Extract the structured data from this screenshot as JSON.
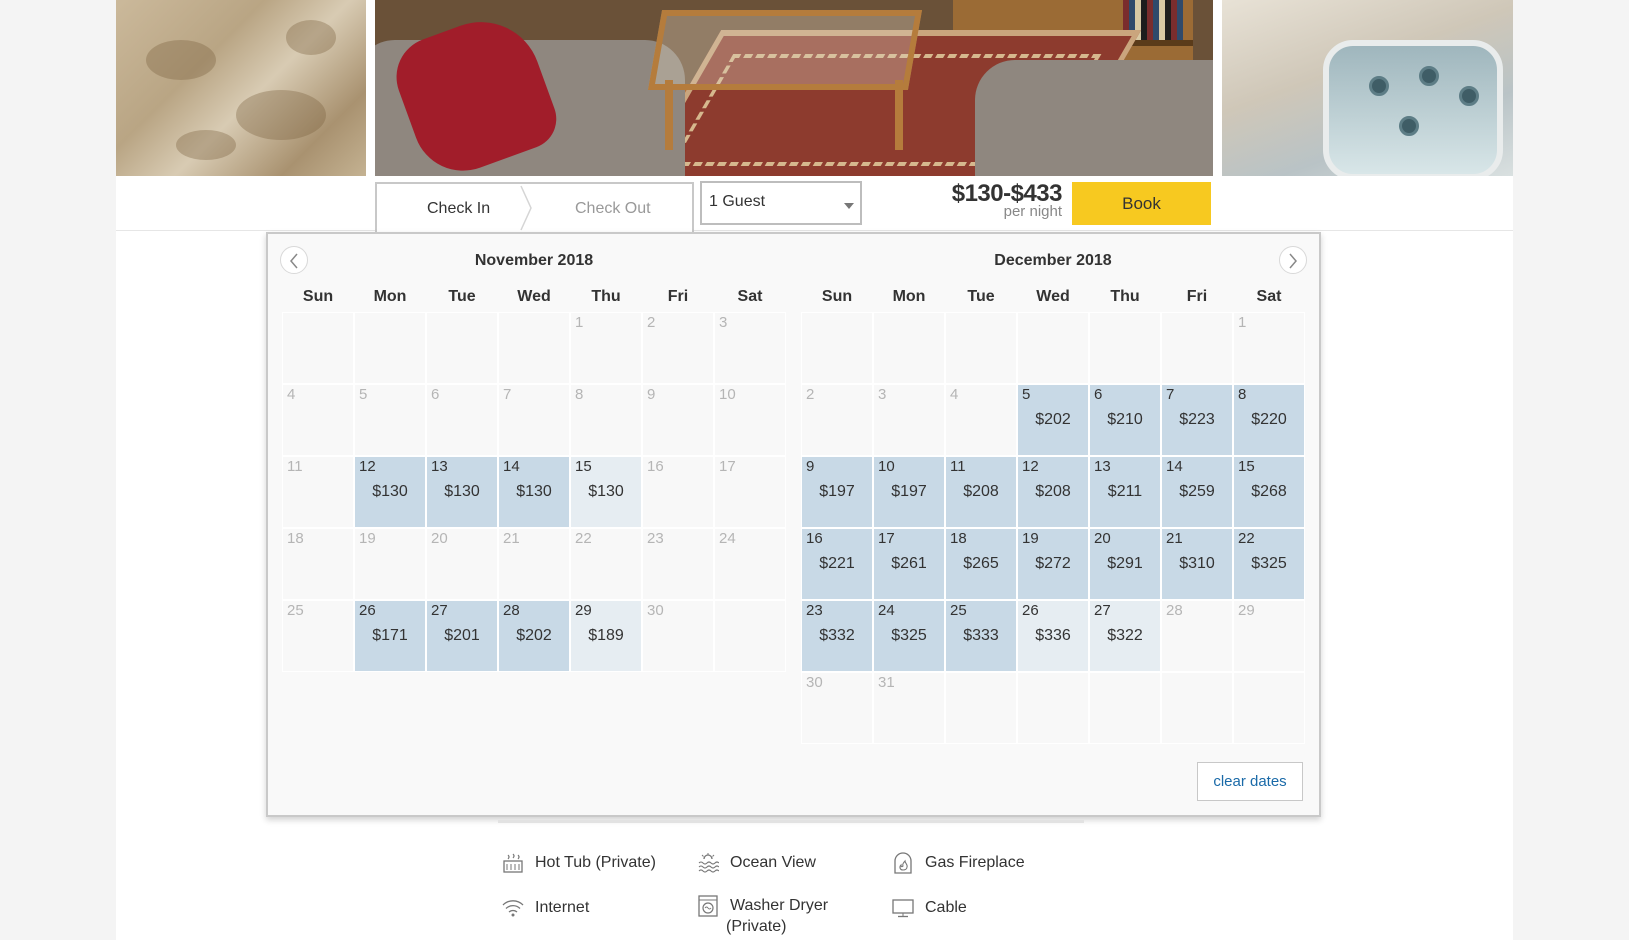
{
  "booking": {
    "check_in_label": "Check In",
    "check_out_label": "Check Out",
    "guests_value": "1 Guest",
    "price_range": "$130-$433",
    "per_night": "per night",
    "book_label": "Book"
  },
  "calendar": {
    "weekdays": [
      "Sun",
      "Mon",
      "Tue",
      "Wed",
      "Thu",
      "Fri",
      "Sat"
    ],
    "months": [
      {
        "title": "November 2018",
        "days": [
          {
            "d": "",
            "p": "",
            "s": "empty"
          },
          {
            "d": "",
            "p": "",
            "s": "empty"
          },
          {
            "d": "",
            "p": "",
            "s": "empty"
          },
          {
            "d": "",
            "p": "",
            "s": "empty"
          },
          {
            "d": "1",
            "p": "",
            "s": "na"
          },
          {
            "d": "2",
            "p": "",
            "s": "na"
          },
          {
            "d": "3",
            "p": "",
            "s": "na"
          },
          {
            "d": "4",
            "p": "",
            "s": "na"
          },
          {
            "d": "5",
            "p": "",
            "s": "na"
          },
          {
            "d": "6",
            "p": "",
            "s": "na"
          },
          {
            "d": "7",
            "p": "",
            "s": "na"
          },
          {
            "d": "8",
            "p": "",
            "s": "na"
          },
          {
            "d": "9",
            "p": "",
            "s": "na"
          },
          {
            "d": "10",
            "p": "",
            "s": "na"
          },
          {
            "d": "11",
            "p": "",
            "s": "na"
          },
          {
            "d": "12",
            "p": "$130",
            "s": "avail"
          },
          {
            "d": "13",
            "p": "$130",
            "s": "avail"
          },
          {
            "d": "14",
            "p": "$130",
            "s": "avail"
          },
          {
            "d": "15",
            "p": "$130",
            "s": "partial"
          },
          {
            "d": "16",
            "p": "",
            "s": "na"
          },
          {
            "d": "17",
            "p": "",
            "s": "na"
          },
          {
            "d": "18",
            "p": "",
            "s": "na"
          },
          {
            "d": "19",
            "p": "",
            "s": "na"
          },
          {
            "d": "20",
            "p": "",
            "s": "na"
          },
          {
            "d": "21",
            "p": "",
            "s": "na"
          },
          {
            "d": "22",
            "p": "",
            "s": "na"
          },
          {
            "d": "23",
            "p": "",
            "s": "na"
          },
          {
            "d": "24",
            "p": "",
            "s": "na"
          },
          {
            "d": "25",
            "p": "",
            "s": "na"
          },
          {
            "d": "26",
            "p": "$171",
            "s": "avail"
          },
          {
            "d": "27",
            "p": "$201",
            "s": "avail"
          },
          {
            "d": "28",
            "p": "$202",
            "s": "avail"
          },
          {
            "d": "29",
            "p": "$189",
            "s": "partial"
          },
          {
            "d": "30",
            "p": "",
            "s": "na"
          },
          {
            "d": "",
            "p": "",
            "s": "empty"
          }
        ]
      },
      {
        "title": "December 2018",
        "days": [
          {
            "d": "",
            "p": "",
            "s": "empty"
          },
          {
            "d": "",
            "p": "",
            "s": "empty"
          },
          {
            "d": "",
            "p": "",
            "s": "empty"
          },
          {
            "d": "",
            "p": "",
            "s": "empty"
          },
          {
            "d": "",
            "p": "",
            "s": "empty"
          },
          {
            "d": "",
            "p": "",
            "s": "empty"
          },
          {
            "d": "1",
            "p": "",
            "s": "na"
          },
          {
            "d": "2",
            "p": "",
            "s": "na"
          },
          {
            "d": "3",
            "p": "",
            "s": "na"
          },
          {
            "d": "4",
            "p": "",
            "s": "na"
          },
          {
            "d": "5",
            "p": "$202",
            "s": "avail"
          },
          {
            "d": "6",
            "p": "$210",
            "s": "avail"
          },
          {
            "d": "7",
            "p": "$223",
            "s": "avail"
          },
          {
            "d": "8",
            "p": "$220",
            "s": "avail"
          },
          {
            "d": "9",
            "p": "$197",
            "s": "avail"
          },
          {
            "d": "10",
            "p": "$197",
            "s": "avail"
          },
          {
            "d": "11",
            "p": "$208",
            "s": "avail"
          },
          {
            "d": "12",
            "p": "$208",
            "s": "avail"
          },
          {
            "d": "13",
            "p": "$211",
            "s": "avail"
          },
          {
            "d": "14",
            "p": "$259",
            "s": "avail"
          },
          {
            "d": "15",
            "p": "$268",
            "s": "avail"
          },
          {
            "d": "16",
            "p": "$221",
            "s": "avail"
          },
          {
            "d": "17",
            "p": "$261",
            "s": "avail"
          },
          {
            "d": "18",
            "p": "$265",
            "s": "avail"
          },
          {
            "d": "19",
            "p": "$272",
            "s": "avail"
          },
          {
            "d": "20",
            "p": "$291",
            "s": "avail"
          },
          {
            "d": "21",
            "p": "$310",
            "s": "avail"
          },
          {
            "d": "22",
            "p": "$325",
            "s": "avail"
          },
          {
            "d": "23",
            "p": "$332",
            "s": "avail"
          },
          {
            "d": "24",
            "p": "$325",
            "s": "avail"
          },
          {
            "d": "25",
            "p": "$333",
            "s": "avail"
          },
          {
            "d": "26",
            "p": "$336",
            "s": "partial"
          },
          {
            "d": "27",
            "p": "$322",
            "s": "partial"
          },
          {
            "d": "28",
            "p": "",
            "s": "na"
          },
          {
            "d": "29",
            "p": "",
            "s": "na"
          },
          {
            "d": "30",
            "p": "",
            "s": "na"
          },
          {
            "d": "31",
            "p": "",
            "s": "na"
          },
          {
            "d": "",
            "p": "",
            "s": "empty"
          },
          {
            "d": "",
            "p": "",
            "s": "empty"
          },
          {
            "d": "",
            "p": "",
            "s": "empty"
          },
          {
            "d": "",
            "p": "",
            "s": "empty"
          },
          {
            "d": "",
            "p": "",
            "s": "empty"
          }
        ]
      }
    ],
    "clear_dates_label": "clear dates"
  },
  "amenities": [
    {
      "label": "Hot Tub (Private)",
      "icon": "hot-tub-icon"
    },
    {
      "label": "Ocean View",
      "icon": "ocean-view-icon"
    },
    {
      "label": "Gas Fireplace",
      "icon": "fireplace-icon"
    },
    {
      "label": "Internet",
      "icon": "wifi-icon"
    },
    {
      "label": "Washer Dryer",
      "label2": "(Private)",
      "icon": "washer-icon"
    },
    {
      "label": "Cable",
      "icon": "tv-icon"
    }
  ],
  "colors": {
    "available": "#c8d9e6",
    "checkout_only": "#e6edf2",
    "book_button": "#f7c920",
    "link": "#1a6aa8"
  }
}
